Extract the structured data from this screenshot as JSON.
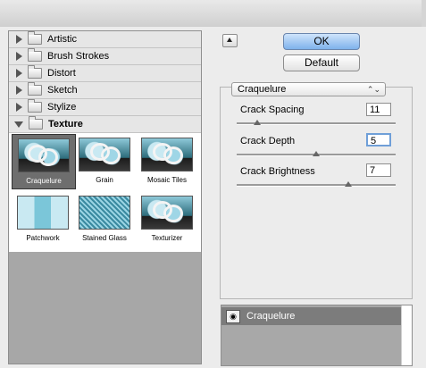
{
  "categories": [
    {
      "label": "Artistic",
      "expanded": false
    },
    {
      "label": "Brush Strokes",
      "expanded": false
    },
    {
      "label": "Distort",
      "expanded": false
    },
    {
      "label": "Sketch",
      "expanded": false
    },
    {
      "label": "Stylize",
      "expanded": false
    },
    {
      "label": "Texture",
      "expanded": true
    }
  ],
  "thumbnails": [
    {
      "label": "Craquelure",
      "selected": true
    },
    {
      "label": "Grain",
      "selected": false
    },
    {
      "label": "Mosaic Tiles",
      "selected": false
    },
    {
      "label": "Patchwork",
      "selected": false
    },
    {
      "label": "Stained Glass",
      "selected": false
    },
    {
      "label": "Texturizer",
      "selected": false
    }
  ],
  "buttons": {
    "ok": "OK",
    "default": "Default"
  },
  "filter_select": {
    "value": "Craquelure",
    "arrow": "⌃⌄"
  },
  "params": [
    {
      "label": "Crack Spacing",
      "value": "11",
      "level": 0.13
    },
    {
      "label": "Crack Depth",
      "value": "5",
      "level": 0.5
    },
    {
      "label": "Crack Brightness",
      "value": "7",
      "level": 0.7
    }
  ],
  "layers": [
    {
      "name": "Craquelure",
      "visible": true
    }
  ],
  "colors": {
    "ok_button": "#7fb2ec",
    "selection": "#6e6e6e",
    "focus_ring": "#6f9fd8"
  }
}
